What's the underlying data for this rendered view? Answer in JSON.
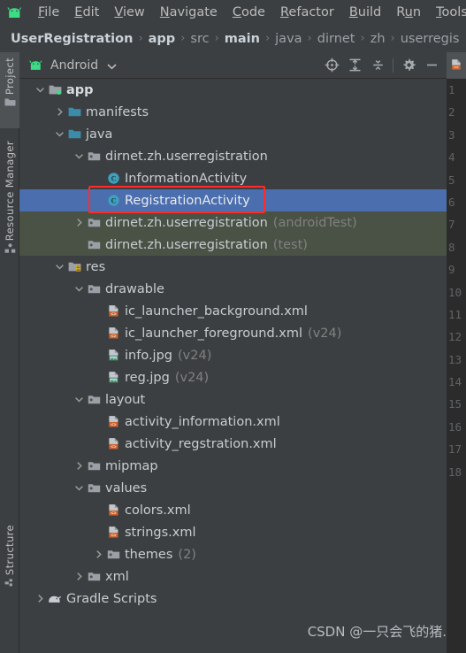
{
  "window": {
    "theme_bg": "#3c3f41",
    "accent_selection": "#4b6eaf",
    "annotation_color": "#ff2b2b",
    "test_source_bg": "#4a5245"
  },
  "menubar": {
    "logo_icon": "android-logo-icon",
    "items": [
      {
        "label": "File",
        "mnemonic": "F"
      },
      {
        "label": "Edit",
        "mnemonic": "E"
      },
      {
        "label": "View",
        "mnemonic": "V"
      },
      {
        "label": "Navigate",
        "mnemonic": "N"
      },
      {
        "label": "Code",
        "mnemonic": "C"
      },
      {
        "label": "Refactor",
        "mnemonic": "R"
      },
      {
        "label": "Build",
        "mnemonic": "B"
      },
      {
        "label": "Run",
        "mnemonic": "u"
      },
      {
        "label": "Tools",
        "mnemonic": "T"
      }
    ]
  },
  "breadcrumb": {
    "separator": "›",
    "items": [
      {
        "label": "UserRegistration",
        "bold": true
      },
      {
        "label": "app",
        "bold": true
      },
      {
        "label": "src",
        "bold": false
      },
      {
        "label": "main",
        "bold": true
      },
      {
        "label": "java",
        "bold": false
      },
      {
        "label": "dirnet",
        "bold": false
      },
      {
        "label": "zh",
        "bold": false
      },
      {
        "label": "userregis",
        "bold": false
      }
    ]
  },
  "toolstrip": {
    "buttons": [
      {
        "label": "Project",
        "icon": "folder-icon",
        "active": true
      },
      {
        "label": "Resource Manager",
        "icon": "resource-manager-icon",
        "active": false
      },
      {
        "label": "Structure",
        "icon": "structure-icon",
        "active": false
      }
    ]
  },
  "panel": {
    "title": "Android",
    "logo_icon": "android-logo-icon",
    "dropdown_icon": "chevron-down-icon",
    "tools": [
      {
        "name": "select-opened-file-icon",
        "title": "Select Opened File"
      },
      {
        "name": "expand-all-icon",
        "title": "Expand All"
      },
      {
        "name": "collapse-all-icon",
        "title": "Collapse All"
      },
      {
        "name": "settings-gear-icon",
        "title": "Settings"
      },
      {
        "name": "hide-panel-icon",
        "title": "Hide"
      }
    ]
  },
  "tree": {
    "rows": [
      {
        "indent": 0,
        "twisty": "down",
        "icon": "module-folder-icon",
        "label": "app",
        "suffix": "",
        "bold": true,
        "state": "normal"
      },
      {
        "indent": 1,
        "twisty": "right",
        "icon": "folder-blue-icon",
        "label": "manifests",
        "suffix": "",
        "bold": false,
        "state": "normal"
      },
      {
        "indent": 1,
        "twisty": "down",
        "icon": "folder-blue-icon",
        "label": "java",
        "suffix": "",
        "bold": false,
        "state": "normal"
      },
      {
        "indent": 2,
        "twisty": "down",
        "icon": "package-icon",
        "label": "dirnet.zh.userregistration",
        "suffix": "",
        "bold": false,
        "state": "normal"
      },
      {
        "indent": 3,
        "twisty": "none",
        "icon": "class-icon",
        "label": "InformationActivity",
        "suffix": "",
        "bold": false,
        "state": "normal"
      },
      {
        "indent": 3,
        "twisty": "none",
        "icon": "class-icon",
        "label": "RegistrationActivity",
        "suffix": "",
        "bold": false,
        "state": "selected"
      },
      {
        "indent": 2,
        "twisty": "right",
        "icon": "package-icon",
        "label": "dirnet.zh.userregistration",
        "suffix": "(androidTest)",
        "bold": false,
        "state": "test"
      },
      {
        "indent": 2,
        "twisty": "none",
        "icon": "package-icon",
        "label": "dirnet.zh.userregistration",
        "suffix": "(test)",
        "bold": false,
        "state": "test"
      },
      {
        "indent": 1,
        "twisty": "down",
        "icon": "res-folder-icon",
        "label": "res",
        "suffix": "",
        "bold": false,
        "state": "normal"
      },
      {
        "indent": 2,
        "twisty": "down",
        "icon": "package-icon",
        "label": "drawable",
        "suffix": "",
        "bold": false,
        "state": "normal"
      },
      {
        "indent": 3,
        "twisty": "none",
        "icon": "xml-file-icon",
        "label": "ic_launcher_background.xml",
        "suffix": "",
        "bold": false,
        "state": "normal"
      },
      {
        "indent": 3,
        "twisty": "none",
        "icon": "xml-file-icon",
        "label": "ic_launcher_foreground.xml",
        "suffix": "(v24)",
        "bold": false,
        "state": "normal"
      },
      {
        "indent": 3,
        "twisty": "none",
        "icon": "image-file-icon",
        "label": "info.jpg",
        "suffix": "(v24)",
        "bold": false,
        "state": "normal"
      },
      {
        "indent": 3,
        "twisty": "none",
        "icon": "image-file-icon",
        "label": "reg.jpg",
        "suffix": "(v24)",
        "bold": false,
        "state": "normal"
      },
      {
        "indent": 2,
        "twisty": "down",
        "icon": "package-icon",
        "label": "layout",
        "suffix": "",
        "bold": false,
        "state": "normal"
      },
      {
        "indent": 3,
        "twisty": "none",
        "icon": "xml-file-icon",
        "label": "activity_information.xml",
        "suffix": "",
        "bold": false,
        "state": "normal"
      },
      {
        "indent": 3,
        "twisty": "none",
        "icon": "xml-file-icon",
        "label": "activity_regstration.xml",
        "suffix": "",
        "bold": false,
        "state": "normal"
      },
      {
        "indent": 2,
        "twisty": "right",
        "icon": "package-icon",
        "label": "mipmap",
        "suffix": "",
        "bold": false,
        "state": "normal"
      },
      {
        "indent": 2,
        "twisty": "down",
        "icon": "package-icon",
        "label": "values",
        "suffix": "",
        "bold": false,
        "state": "normal"
      },
      {
        "indent": 3,
        "twisty": "none",
        "icon": "xml-file-icon",
        "label": "colors.xml",
        "suffix": "",
        "bold": false,
        "state": "normal"
      },
      {
        "indent": 3,
        "twisty": "none",
        "icon": "xml-file-icon",
        "label": "strings.xml",
        "suffix": "",
        "bold": false,
        "state": "normal"
      },
      {
        "indent": 3,
        "twisty": "right",
        "icon": "package-icon",
        "label": "themes",
        "suffix": "(2)",
        "bold": false,
        "state": "normal"
      },
      {
        "indent": 2,
        "twisty": "right",
        "icon": "package-icon",
        "label": "xml",
        "suffix": "",
        "bold": false,
        "state": "normal"
      },
      {
        "indent": 0,
        "twisty": "right",
        "icon": "gradle-icon",
        "label": "Gradle Scripts",
        "suffix": "",
        "bold": false,
        "state": "normal"
      }
    ],
    "annotation": {
      "target_row": "RegistrationActivity",
      "shape": "rectangle"
    }
  },
  "editor_sliver": {
    "tab_icon": "xml-file-icon",
    "line_numbers": [
      "1",
      "2",
      "3",
      "4",
      "5",
      "6",
      "7",
      "8",
      "9",
      "10",
      "11",
      "12",
      "13",
      "14",
      "15",
      "16",
      "17",
      "18"
    ]
  },
  "watermark": {
    "text": "CSDN @一只会飞的猪."
  }
}
